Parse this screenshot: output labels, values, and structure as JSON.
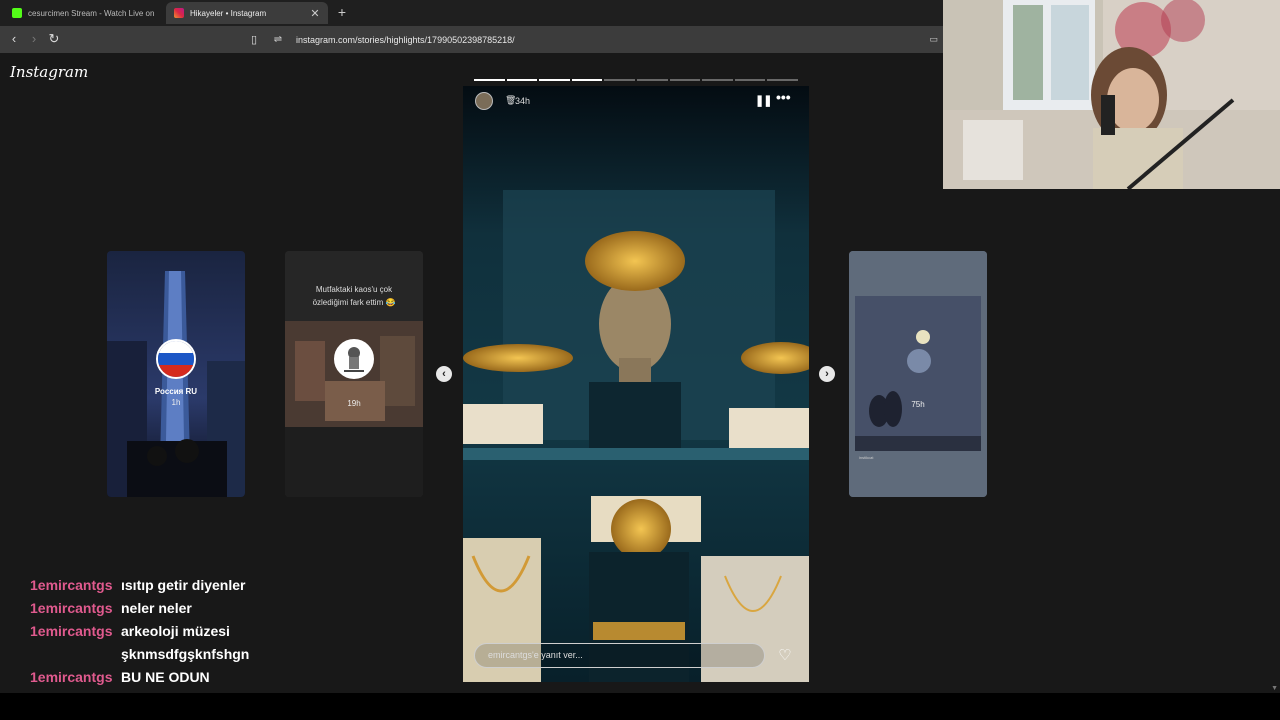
{
  "browser": {
    "tabs": [
      {
        "title": "cesurcimen Stream - Watch Live on K",
        "favicon_color": "#53fc18",
        "active": false
      },
      {
        "title": "Hikayeler • Instagram",
        "favicon_color": "#d6249f",
        "active": true
      }
    ],
    "new_tab_icon": "plus-icon",
    "url": "instagram.com/stories/highlights/17990502398785218/"
  },
  "instagram": {
    "logo": "Instagram",
    "side_stories": [
      {
        "label": "Россия RU",
        "time": "1h"
      },
      {
        "caption_line1": "Mutfaktaki kaos'u çok",
        "caption_line2": "özlediğimi fark ettim 😂",
        "time": "19h"
      },
      {
        "time": "75h",
        "footer": "instikcat"
      }
    ],
    "main_story": {
      "time": "34h",
      "progress_total": 10,
      "progress_done": 4,
      "reply_placeholder": "emircantgs'e yanıt ver..."
    }
  },
  "chat": [
    {
      "user": "1emircantgs",
      "message": "ısıtıp getir diyenler"
    },
    {
      "user": "1emircantgs",
      "message": "neler neler"
    },
    {
      "user": "1emircantgs",
      "message": "arkeoloji müzesi şknmsdfgşknfshgn"
    },
    {
      "user": "1emircantgs",
      "message": "BU NE ODUN KNSFDGLKNSFGN"
    }
  ],
  "colors": {
    "chat_user": "#e05a8e",
    "page_bg": "#181818",
    "story_bg": "#071822"
  }
}
